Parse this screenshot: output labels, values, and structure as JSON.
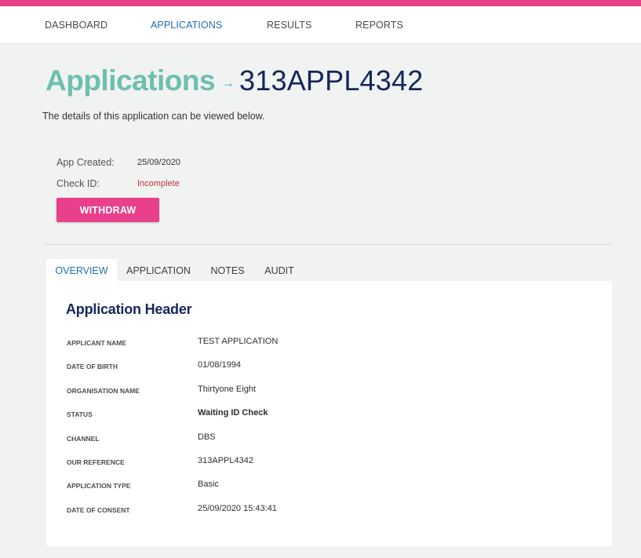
{
  "nav": {
    "items": [
      {
        "label": "DASHBOARD"
      },
      {
        "label": "APPLICATIONS"
      },
      {
        "label": "RESULTS"
      },
      {
        "label": "REPORTS"
      }
    ],
    "active": "APPLICATIONS"
  },
  "page": {
    "title_section": "Applications",
    "title_arrow": "→",
    "title_id": "313APPL4342",
    "subtitle": "The details of this application can be viewed below."
  },
  "meta": {
    "app_created_label": "App Created:",
    "app_created_value": "25/09/2020",
    "check_id_label": "Check ID:",
    "check_id_value": "Incomplete"
  },
  "actions": {
    "withdraw_label": "WITHDRAW"
  },
  "tabs": [
    {
      "label": "OVERVIEW",
      "active": true
    },
    {
      "label": "APPLICATION",
      "active": false
    },
    {
      "label": "NOTES",
      "active": false
    },
    {
      "label": "AUDIT",
      "active": false
    }
  ],
  "overview": {
    "title": "Application Header",
    "fields": [
      {
        "label": "APPLICANT NAME",
        "value": "TEST APPLICATION"
      },
      {
        "label": "DATE OF BIRTH",
        "value": "01/08/1994"
      },
      {
        "label": "ORGANISATION NAME",
        "value": "Thirtyone Eight"
      },
      {
        "label": "STATUS",
        "value": "Waiting ID Check"
      },
      {
        "label": "CHANNEL",
        "value": "DBS"
      },
      {
        "label": "OUR REFERENCE",
        "value": "313APPL4342"
      },
      {
        "label": "APPLICATION TYPE",
        "value": "Basic"
      },
      {
        "label": "DATE OF CONSENT",
        "value": "25/09/2020 15:43:41"
      }
    ]
  },
  "colors": {
    "accent_pink": "#e8408a",
    "title_teal": "#6dbfb0",
    "title_navy": "#14275a",
    "link_blue": "#1f6fb2",
    "warning_red": "#c0392b"
  }
}
